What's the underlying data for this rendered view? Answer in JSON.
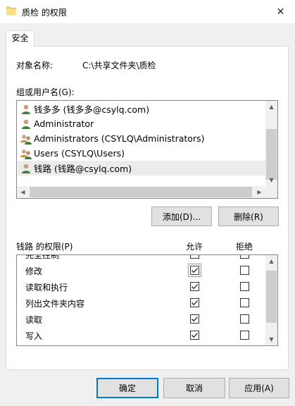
{
  "window": {
    "title": "质检 的权限",
    "close_glyph": "✕"
  },
  "tab": {
    "label": "安全"
  },
  "object_name": {
    "label": "对象名称:",
    "value": "C:\\共享文件夹\\质检"
  },
  "groups": {
    "label": "组或用户名(G):",
    "items": [
      {
        "icon": "user-icon",
        "name": "钱多多 (钱多多@csylq.com)",
        "selected": false
      },
      {
        "icon": "user-icon",
        "name": "Administrator",
        "selected": false
      },
      {
        "icon": "group-icon",
        "name": "Administrators (CSYLQ\\Administrators)",
        "selected": false
      },
      {
        "icon": "group-icon",
        "name": "Users (CSYLQ\\Users)",
        "selected": false
      },
      {
        "icon": "user-icon",
        "name": "钱路 (钱路@csylq.com)",
        "selected": true
      }
    ]
  },
  "buttons": {
    "add": "添加(D)...",
    "remove": "删除(R)"
  },
  "permissions": {
    "label": "钱路 的权限(P)",
    "allow_header": "允许",
    "deny_header": "拒绝",
    "items": [
      {
        "name": "完全控制",
        "allow": false,
        "deny": false
      },
      {
        "name": "修改",
        "allow": true,
        "deny": false
      },
      {
        "name": "读取和执行",
        "allow": true,
        "deny": false
      },
      {
        "name": "列出文件夹内容",
        "allow": true,
        "deny": false
      },
      {
        "name": "读取",
        "allow": true,
        "deny": false
      },
      {
        "name": "写入",
        "allow": true,
        "deny": false
      }
    ]
  },
  "footer": {
    "ok": "确定",
    "cancel": "取消",
    "apply": "应用(A)"
  },
  "colors": {
    "accent": "#0078d7",
    "selected_row": "#ececec",
    "folder": "#f8d775"
  }
}
